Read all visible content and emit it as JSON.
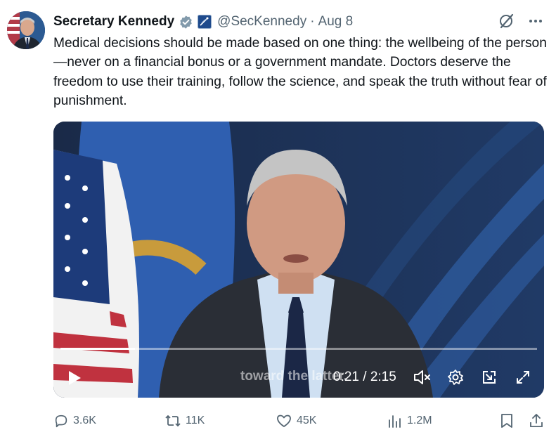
{
  "post": {
    "author_name": "Secretary Kennedy",
    "handle": "@SecKennedy",
    "separator": "·",
    "date": "Aug 8",
    "text": "Medical decisions should be made based on one thing: the wellbeing of the person—never on a financial bonus or a government mandate. Doctors deserve the freedom to use their training, follow the science, and speak the truth without fear of punishment."
  },
  "icons": {
    "verified": "verified-badge-icon",
    "affiliation": "hhs-affiliation-icon",
    "grok": "grok-icon",
    "more": "more-icon"
  },
  "video": {
    "caption": "toward the latter.",
    "current_time": "0:21",
    "time_separator": "/",
    "duration": "2:15",
    "progress_fraction": 0.156,
    "controls": [
      "play-icon",
      "mute-icon",
      "settings-icon",
      "pop-out-icon",
      "fullscreen-icon"
    ]
  },
  "actions": {
    "replies": "3.6K",
    "reposts": "11K",
    "likes": "45K",
    "views": "1.2M"
  },
  "colors": {
    "text": "#0f1419",
    "secondary": "#536471",
    "verified": "#829aab",
    "background": "#ffffff"
  }
}
